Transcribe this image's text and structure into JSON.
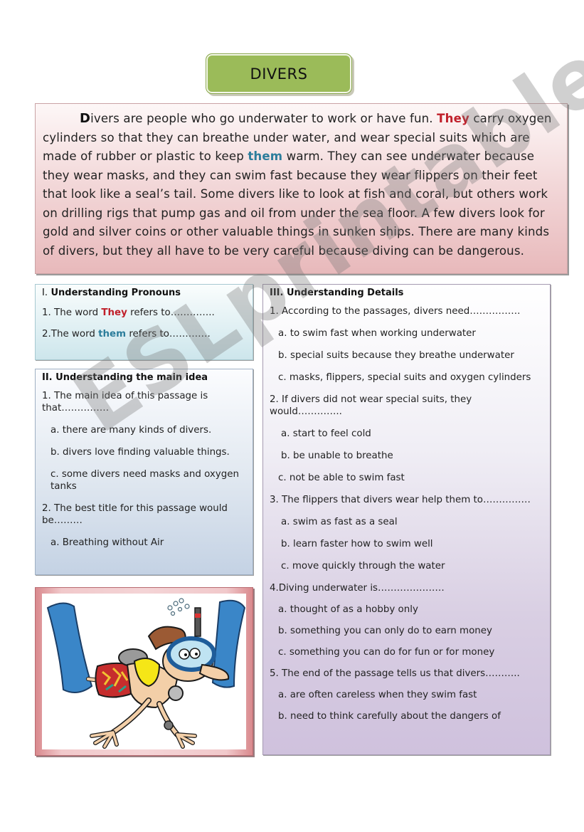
{
  "title": "DIVERS",
  "passage": {
    "dropcap": "D",
    "part1": "ivers are people who go underwater to work or have fun. ",
    "highlight_they": "They",
    "part2": " carry oxygen cylinders so that they can breathe under water, and wear special suits which are made of rubber or plastic to keep ",
    "highlight_them": "them",
    "part3": " warm. They can see underwater because they wear masks, and they can swim fast because they wear flippers on their feet that look like a seal’s tail. Some divers like to look at fish and coral, but others work on drilling rigs that pump gas and oil from under the sea floor. A few divers look for gold and silver coins or other valuable things in sunken ships. There are many kinds of divers, but they all have to be very careful because diving can be dangerous."
  },
  "section1": {
    "numeral": "I.",
    "heading": " Understanding Pronouns",
    "q1_prefix": "1. The word ",
    "q1_word": "They",
    "q1_suffix": " refers to…………..",
    "q2_prefix": "2.The word ",
    "q2_word": "them",
    "q2_suffix": " refers to…………."
  },
  "section2": {
    "heading": "II. Understanding the main idea",
    "q1": "1. The main idea of this passage is that……………",
    "q1_options": [
      "a. there are many kinds of divers.",
      "b. divers love finding valuable things.",
      "c. some divers need masks and oxygen tanks"
    ],
    "q2": "2. The best title for this passage would be………",
    "q2_options": [
      "a. Breathing without Air"
    ]
  },
  "section3": {
    "heading": "III. Understanding Details",
    "questions": [
      {
        "q": "1. According to the passages, divers need…………….",
        "options": [
          "a. to swim fast when working underwater",
          "b. special suits because they breathe underwater",
          "c. masks, flippers, special suits and oxygen cylinders"
        ]
      },
      {
        "q": "2. If divers did not wear special suits, they would…………..",
        "options": [
          "a. start to feel cold",
          "b. be unable to breathe",
          "c. not be able to swim fast"
        ]
      },
      {
        "q": "3. The flippers that divers wear help them to……………",
        "options": [
          "a. swim as fast as a seal",
          "b. learn faster how to swim well",
          "c. move quickly through the water"
        ]
      },
      {
        "q": "4.Diving underwater is…………………",
        "options": [
          "a. thought of as a hobby only",
          "b. something you can only do to earn money",
          "c. something  you can do for fun or for money"
        ]
      },
      {
        "q": "5. The end of the passage tells us that divers………..",
        "options": [
          "a. are often careless when they swim fast",
          "b. need to think carefully about the dangers of"
        ]
      }
    ]
  },
  "illustration": {
    "description": "cartoon diver with flippers and mask"
  },
  "watermark": "ESLprintables.com",
  "colors": {
    "title_bg": "#9bbb59",
    "highlight_red": "#c0202b",
    "highlight_blue": "#2c7d9b"
  }
}
